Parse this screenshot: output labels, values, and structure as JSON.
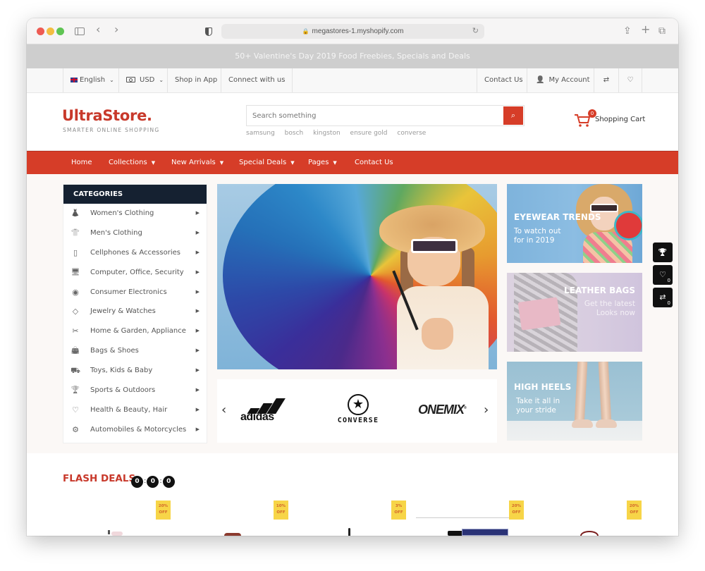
{
  "browser": {
    "url": "megastores-1.myshopify.com",
    "back_label": "‹",
    "forward_label": "›",
    "share_label": "⇪",
    "newtab_label": "+",
    "tabs_label": "⧉",
    "reload_label": "↻",
    "lock_label": "🔒"
  },
  "promo": {
    "text": "50+ Valentine's Day 2019 Food Freebies, Specials and Deals"
  },
  "topbar": {
    "language": "English",
    "currency": "USD",
    "shop_in_app": "Shop in App",
    "connect": "Connect with us",
    "contact": "Contact Us",
    "account": "My Account",
    "account_icon": "👤",
    "compare_icon": "⇄",
    "wishlist_icon": "♡",
    "caret": "⌄"
  },
  "header": {
    "logo": "UltraStore.",
    "tagline": "SMARTER ONLINE SHOPPING",
    "search_placeholder": "Search something",
    "search_icon": "⌕",
    "suggestions": [
      "samsung",
      "bosch",
      "kingston",
      "ensure gold",
      "converse"
    ],
    "cart_count": "0",
    "cart_label": "Shopping Cart"
  },
  "nav": {
    "items": [
      {
        "label": "Home",
        "dropdown": ""
      },
      {
        "label": "Collections",
        "dropdown": "▼"
      },
      {
        "label": "New Arrivals",
        "dropdown": "▼"
      },
      {
        "label": "Special Deals",
        "dropdown": "▼"
      },
      {
        "label": "Pages",
        "dropdown": "▼"
      },
      {
        "label": "Contact Us",
        "dropdown": ""
      }
    ]
  },
  "categories": {
    "title": "CATEGORIES",
    "arrow": "▶",
    "items": [
      {
        "label": "Women's Clothing",
        "icon": "👗"
      },
      {
        "label": "Men's Clothing",
        "icon": "👕"
      },
      {
        "label": "Cellphones & Accessories",
        "icon": "▯"
      },
      {
        "label": "Computer, Office, Security",
        "icon": "🖥"
      },
      {
        "label": "Consumer Electronics",
        "icon": "◉"
      },
      {
        "label": "Jewelry & Watches",
        "icon": "◇"
      },
      {
        "label": "Home & Garden, Appliance",
        "icon": "✂"
      },
      {
        "label": "Bags & Shoes",
        "icon": "👜"
      },
      {
        "label": "Toys, Kids & Baby",
        "icon": "⛟"
      },
      {
        "label": "Sports & Outdoors",
        "icon": "🏆"
      },
      {
        "label": "Health & Beauty, Hair",
        "icon": "♡"
      },
      {
        "label": "Automobiles & Motorcycles",
        "icon": "⚙"
      }
    ]
  },
  "brands": {
    "prev": "‹",
    "next": "›",
    "items": [
      "adidas",
      "CONVERSE",
      "ONEMIX"
    ],
    "converse_star": "★",
    "onemix_reg": "®"
  },
  "banners": [
    {
      "title": "EYEWEAR TRENDS",
      "subtitle_1": "To watch out",
      "subtitle_2": "for in 2019"
    },
    {
      "title": "LEATHER BAGS",
      "subtitle_1": "Get the latest",
      "subtitle_2": "Looks now"
    },
    {
      "title": "HIGH HEELS",
      "subtitle_1": "Take it all in",
      "subtitle_2": "your stride"
    }
  ],
  "side_tools": {
    "trophy_icon": "🏆",
    "wishlist_icon": "♡",
    "wishlist_count": "0",
    "compare_icon": "⇄",
    "compare_count": "0"
  },
  "flash_deals": {
    "title": "FLASH DEALS",
    "timer": [
      "0",
      "0",
      "0"
    ],
    "separator": ":",
    "badges": [
      {
        "pct": "20%",
        "off": "OFF"
      },
      {
        "pct": "10%",
        "off": "OFF"
      },
      {
        "pct": "3%",
        "off": "OFF"
      },
      {
        "pct": "20%",
        "off": "OFF"
      },
      {
        "pct": "20%",
        "off": "OFF"
      }
    ]
  },
  "colors": {
    "brand_red": "#d63d28",
    "category_header": "#152131",
    "offer_badge": "#f7d548"
  }
}
